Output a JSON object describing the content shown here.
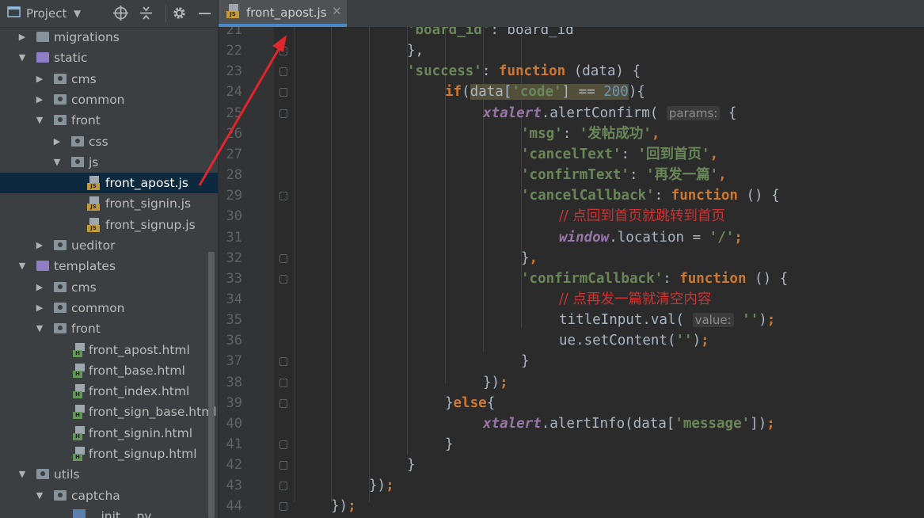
{
  "project_panel": {
    "title": "Project",
    "tree": [
      {
        "label": "migrations",
        "depth": 0,
        "type": "folder",
        "state": "collapsed"
      },
      {
        "label": "static",
        "depth": 0,
        "type": "folder-purple",
        "state": "expanded"
      },
      {
        "label": "cms",
        "depth": 1,
        "type": "package",
        "state": "collapsed"
      },
      {
        "label": "common",
        "depth": 1,
        "type": "package",
        "state": "collapsed"
      },
      {
        "label": "front",
        "depth": 1,
        "type": "package",
        "state": "expanded"
      },
      {
        "label": "css",
        "depth": 2,
        "type": "package",
        "state": "collapsed"
      },
      {
        "label": "js",
        "depth": 2,
        "type": "package",
        "state": "expanded"
      },
      {
        "label": "front_apost.js",
        "depth": 3,
        "type": "js",
        "selected": true
      },
      {
        "label": "front_signin.js",
        "depth": 3,
        "type": "js"
      },
      {
        "label": "front_signup.js",
        "depth": 3,
        "type": "js"
      },
      {
        "label": "ueditor",
        "depth": 1,
        "type": "package",
        "state": "collapsed"
      },
      {
        "label": "templates",
        "depth": 0,
        "type": "folder-purple",
        "state": "expanded"
      },
      {
        "label": "cms",
        "depth": 1,
        "type": "package",
        "state": "collapsed"
      },
      {
        "label": "common",
        "depth": 1,
        "type": "package",
        "state": "collapsed"
      },
      {
        "label": "front",
        "depth": 1,
        "type": "package",
        "state": "expanded"
      },
      {
        "label": "front_apost.html",
        "depth": 2,
        "type": "html"
      },
      {
        "label": "front_base.html",
        "depth": 2,
        "type": "html"
      },
      {
        "label": "front_index.html",
        "depth": 2,
        "type": "html"
      },
      {
        "label": "front_sign_base.html",
        "depth": 2,
        "type": "html"
      },
      {
        "label": "front_signin.html",
        "depth": 2,
        "type": "html"
      },
      {
        "label": "front_signup.html",
        "depth": 2,
        "type": "html"
      },
      {
        "label": "utils",
        "depth": 0,
        "type": "package",
        "state": "expanded"
      },
      {
        "label": "captcha",
        "depth": 1,
        "type": "package",
        "state": "expanded"
      },
      {
        "label": "__init__.py",
        "depth": 2,
        "type": "py"
      }
    ]
  },
  "toolbar_icons": [
    "project-icon",
    "dropdown-icon",
    "target-icon",
    "collapse-icon",
    "gear-icon",
    "minimize-icon"
  ],
  "editor": {
    "active_tab": "front_apost.js",
    "code_lines": [
      {
        "n": "21",
        "indent": 0,
        "tokens": [
          {
            "t": "s",
            "v": "'board_id'"
          },
          {
            "t": "p",
            "v": ": board_id"
          }
        ]
      },
      {
        "n": "22",
        "indent": 0,
        "tokens": [
          {
            "t": "p",
            "v": "},"
          }
        ]
      },
      {
        "n": "23",
        "indent": 0,
        "tokens": [
          {
            "t": "s",
            "v": "'success'"
          },
          {
            "t": "p",
            "v": ": "
          },
          {
            "t": "k",
            "v": "function"
          },
          {
            "t": "p",
            "v": " (data) {"
          }
        ]
      },
      {
        "n": "24",
        "indent": 1,
        "tokens": [
          {
            "t": "k",
            "v": "if"
          },
          {
            "t": "p",
            "v": "("
          },
          {
            "t": "hl-p",
            "v": "data["
          },
          {
            "t": "hl-s",
            "v": "'code'"
          },
          {
            "t": "hl-p",
            "v": "] == "
          },
          {
            "t": "hl-n",
            "v": "200"
          },
          {
            "t": "p",
            "v": "){"
          }
        ]
      },
      {
        "n": "25",
        "indent": 2,
        "tokens": [
          {
            "t": "g",
            "v": "xtalert"
          },
          {
            "t": "p",
            "v": ".alertConfirm( "
          },
          {
            "t": "hint",
            "v": "params:"
          },
          {
            "t": "p",
            "v": " {"
          }
        ]
      },
      {
        "n": "26",
        "indent": 3,
        "tokens": [
          {
            "t": "s",
            "v": "'msg'"
          },
          {
            "t": "p",
            "v": ": "
          },
          {
            "t": "s",
            "v": "'发帖成功'"
          },
          {
            "t": "k",
            "v": ","
          }
        ]
      },
      {
        "n": "27",
        "indent": 3,
        "tokens": [
          {
            "t": "s",
            "v": "'cancelText'"
          },
          {
            "t": "p",
            "v": ": "
          },
          {
            "t": "s",
            "v": "'回到首页'"
          },
          {
            "t": "k",
            "v": ","
          }
        ]
      },
      {
        "n": "28",
        "indent": 3,
        "tokens": [
          {
            "t": "s",
            "v": "'confirmText'"
          },
          {
            "t": "p",
            "v": ": "
          },
          {
            "t": "s",
            "v": "'再发一篇'"
          },
          {
            "t": "k",
            "v": ","
          }
        ]
      },
      {
        "n": "29",
        "indent": 3,
        "tokens": [
          {
            "t": "s",
            "v": "'cancelCallback'"
          },
          {
            "t": "p",
            "v": ": "
          },
          {
            "t": "k",
            "v": "function"
          },
          {
            "t": "p",
            "v": " () {"
          }
        ]
      },
      {
        "n": "30",
        "indent": 4,
        "tokens": [
          {
            "t": "c",
            "v": "// 点回到首页就跳转到首页"
          }
        ]
      },
      {
        "n": "31",
        "indent": 4,
        "tokens": [
          {
            "t": "g",
            "v": "window"
          },
          {
            "t": "p",
            "v": ".location = "
          },
          {
            "t": "s",
            "v": "'/'"
          },
          {
            "t": "k",
            "v": ";"
          }
        ]
      },
      {
        "n": "32",
        "indent": 3,
        "tokens": [
          {
            "t": "p",
            "v": "}"
          },
          {
            "t": "k",
            "v": ","
          }
        ]
      },
      {
        "n": "33",
        "indent": 3,
        "tokens": [
          {
            "t": "s",
            "v": "'confirmCallback'"
          },
          {
            "t": "p",
            "v": ": "
          },
          {
            "t": "k",
            "v": "function"
          },
          {
            "t": "p",
            "v": " () {"
          }
        ]
      },
      {
        "n": "34",
        "indent": 4,
        "tokens": [
          {
            "t": "c",
            "v": "// 点再发一篇就清空内容"
          }
        ]
      },
      {
        "n": "35",
        "indent": 4,
        "tokens": [
          {
            "t": "p",
            "v": "titleInput.val( "
          },
          {
            "t": "hint",
            "v": "value:"
          },
          {
            "t": "p",
            "v": " "
          },
          {
            "t": "s",
            "v": "''"
          },
          {
            "t": "p",
            "v": ")"
          },
          {
            "t": "k",
            "v": ";"
          }
        ]
      },
      {
        "n": "36",
        "indent": 4,
        "tokens": [
          {
            "t": "p",
            "v": "ue.setContent("
          },
          {
            "t": "s",
            "v": "''"
          },
          {
            "t": "p",
            "v": ")"
          },
          {
            "t": "k",
            "v": ";"
          }
        ]
      },
      {
        "n": "37",
        "indent": 3,
        "tokens": [
          {
            "t": "p",
            "v": "}"
          }
        ]
      },
      {
        "n": "38",
        "indent": 2,
        "tokens": [
          {
            "t": "p",
            "v": "})"
          },
          {
            "t": "k",
            "v": ";"
          }
        ]
      },
      {
        "n": "39",
        "indent": 1,
        "tokens": [
          {
            "t": "p",
            "v": "}"
          },
          {
            "t": "k",
            "v": "else"
          },
          {
            "t": "p",
            "v": "{"
          }
        ]
      },
      {
        "n": "40",
        "indent": 2,
        "tokens": [
          {
            "t": "g",
            "v": "xtalert"
          },
          {
            "t": "p",
            "v": ".alertInfo(data["
          },
          {
            "t": "s",
            "v": "'message'"
          },
          {
            "t": "p",
            "v": "])"
          },
          {
            "t": "k",
            "v": ";"
          }
        ]
      },
      {
        "n": "41",
        "indent": 1,
        "tokens": [
          {
            "t": "p",
            "v": "}"
          }
        ]
      },
      {
        "n": "42",
        "indent": 0,
        "tokens": [
          {
            "t": "p",
            "v": "}"
          }
        ]
      },
      {
        "n": "43",
        "indent": -1,
        "tokens": [
          {
            "t": "p",
            "v": "})"
          },
          {
            "t": "k",
            "v": ";"
          }
        ]
      },
      {
        "n": "44",
        "indent": -2,
        "tokens": [
          {
            "t": "p",
            "v": "})"
          },
          {
            "t": "k",
            "v": ";"
          }
        ]
      }
    ]
  },
  "colors": {
    "keyword": "#cc7832",
    "string": "#6a8759",
    "number": "#6897bb",
    "global": "#9876aa",
    "comment": "#cc3333",
    "selection": "#0d293e",
    "annotation_arrow": "#e0262c"
  }
}
